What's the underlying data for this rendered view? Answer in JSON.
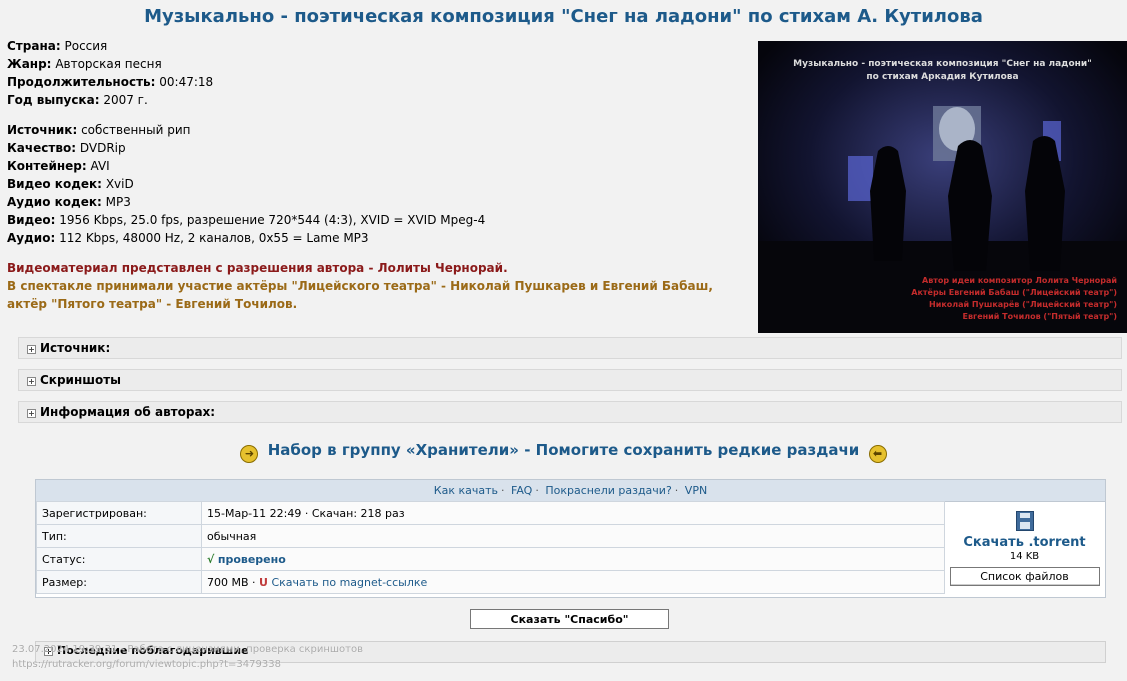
{
  "title": "Музыкально - поэтическая композиция \"Снег на ладони\" по стихам А. Кутилова",
  "info": {
    "country_label": "Страна",
    "country": "Россия",
    "genre_label": "Жанр",
    "genre": "Авторская песня",
    "duration_label": "Продолжительность",
    "duration": "00:47:18",
    "year_label": "Год выпуска",
    "year": "2007 г.",
    "source_label": "Источник",
    "source": "собственный рип",
    "quality_label": "Качество",
    "quality": "DVDRip",
    "container_label": "Контейнер",
    "container": "AVI",
    "vcodec_label": "Видео кодек",
    "vcodec": "XviD",
    "acodec_label": "Аудио кодек",
    "acodec": "MP3",
    "video_label": "Видео",
    "video": "1956 Kbps, 25.0 fps, разрешение 720*544 (4:3), XVID = XVID Mpeg-4",
    "audio_label": "Аудио",
    "audio": "112 Kbps, 48000 Hz, 2 каналов, 0x55 = Lame MP3",
    "note_red": "Видеоматериал представлен с разрешения автора - Лолиты Чернорай.",
    "note_brown_1": "В спектакле принимали участие актёры \"Лицейского театра\" - Николай Пушкарев и Евгений Бабаш,",
    "note_brown_2": "актёр \"Пятого театра\" - Евгений Точилов."
  },
  "poster": {
    "title_1": "Музыкально - поэтическая композиция \"Снег на ладони\"",
    "title_2": "по стихам Аркадия Кутилова",
    "credit_1": "Автор идеи композитор Лолита Чернорай",
    "credit_2": "Актёры Евгений Бабаш (\"Лицейский театр\")",
    "credit_3": "Николай Пушкарёв (\"Лицейский театр\")",
    "credit_4": "Евгений Точилов (\"Пятый театр\")"
  },
  "spoilers": [
    "Источник:",
    "Скриншоты",
    "Информация об авторах:"
  ],
  "promo": {
    "left": "Набор в группу «Хранители»",
    "dash": "-",
    "right": "Помогите сохранить редкие раздачи"
  },
  "download": {
    "links": [
      "Как качать",
      "FAQ",
      "Покраснели раздачи?",
      "VPN"
    ],
    "registered_label": "Зарегистрирован:",
    "registered": "15-Мар-11 22:49",
    "downloaded": "Скачан: 218 раз",
    "type_label": "Тип:",
    "type": "обычная",
    "status_label": "Статус:",
    "status_mark": "√",
    "status": "проверено",
    "size_label": "Размер:",
    "size": "700 MB",
    "magnet": "Скачать по magnet-ссылке",
    "torrent_link": "Скачать .torrent",
    "torrent_size": "14 KB",
    "files_button": "Список файлов"
  },
  "thanks_button": "Сказать \"Спасибо\"",
  "last_thanks": "Последние поблагодарившие",
  "overlay": {
    "line1": "23.07.2024 19:39:31 - Работа с лицензиями, проверка скриншотов",
    "line2": "https://rutracker.org/forum/viewtopic.php?t=3479338"
  }
}
